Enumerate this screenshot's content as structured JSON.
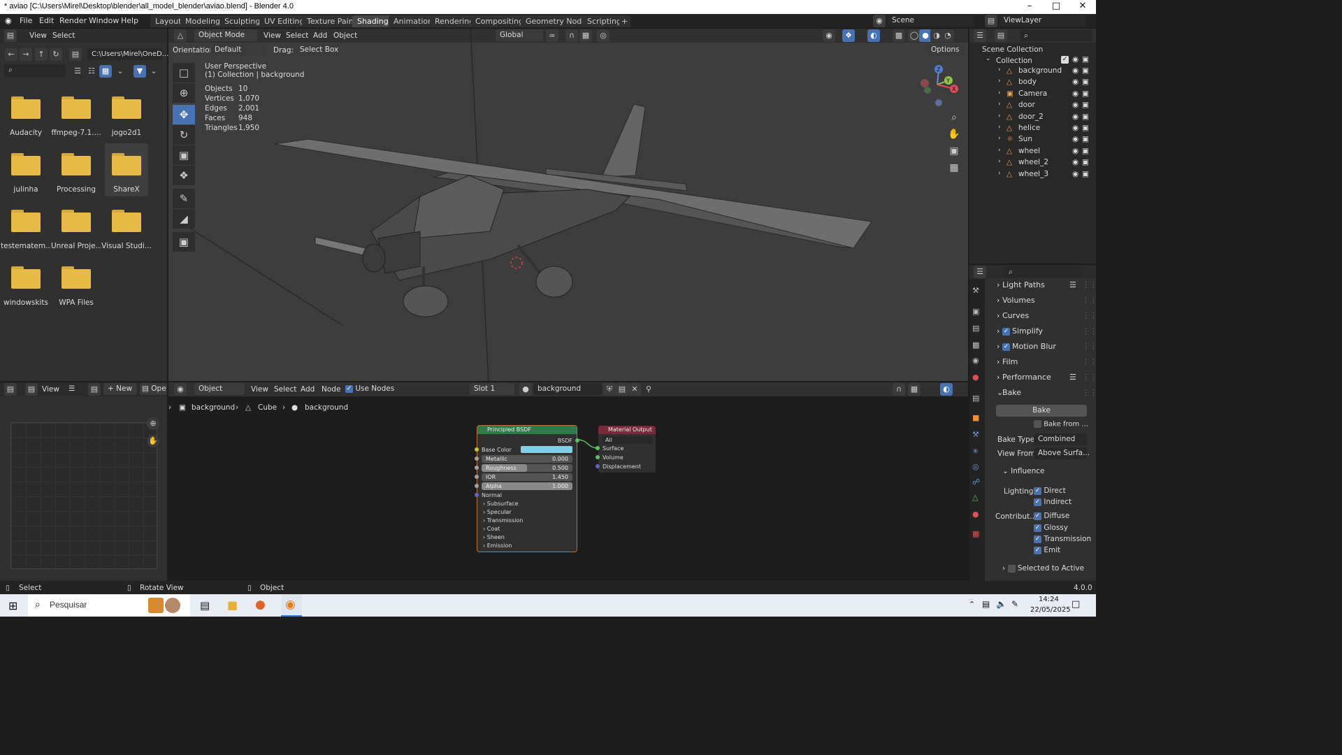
{
  "window": {
    "title": "* aviao [C:\\Users\\Mirel\\Desktop\\blender\\all_model_blender\\aviao.blend] - Blender 4.0"
  },
  "menu": [
    "File",
    "Edit",
    "Render",
    "Window",
    "Help"
  ],
  "workspaces": [
    "Layout",
    "Modeling",
    "Sculpting",
    "UV Editing",
    "Texture Paint",
    "Shading",
    "Animation",
    "Rendering",
    "Compositing",
    "Geometry Nodes",
    "Scripting"
  ],
  "active_workspace": "Shading",
  "scene": {
    "label": "Scene",
    "viewlayer": "ViewLayer"
  },
  "file_browser": {
    "menu": [
      "View",
      "Select"
    ],
    "path": "C:\\Users\\Mirel\\OneD...",
    "folders": [
      "Audacity",
      "ffmpeg-7.1....",
      "jogo2d1",
      "julinha",
      "Processing",
      "ShareX",
      "testematem...",
      "Unreal Proje...",
      "Visual Studi...",
      "windowskits",
      "WPA Files"
    ]
  },
  "viewport": {
    "mode": "Object Mode",
    "menu": [
      "View",
      "Select",
      "Add",
      "Object"
    ],
    "transform": "Global",
    "orientation_label": "Orientation:",
    "orientation": "Default",
    "drag_label": "Drag:",
    "drag": "Select Box",
    "options": "Options",
    "perspective": "User Perspective",
    "collection": "(1) Collection | background",
    "stats": [
      {
        "k": "Objects",
        "v": "10"
      },
      {
        "k": "Vertices",
        "v": "1,070"
      },
      {
        "k": "Edges",
        "v": "2,001"
      },
      {
        "k": "Faces",
        "v": "948"
      },
      {
        "k": "Triangles",
        "v": "1,950"
      }
    ],
    "gizmo": {
      "z": "Z",
      "y": "Y",
      "x": "X"
    }
  },
  "outliner": {
    "root": "Scene Collection",
    "collection": "Collection",
    "items": [
      "background",
      "body",
      "Camera",
      "door",
      "door_2",
      "helice",
      "Sun",
      "wheel",
      "wheel_2",
      "wheel_3"
    ]
  },
  "properties": {
    "panels": [
      "Light Paths",
      "Volumes",
      "Curves",
      "Simplify",
      "Motion Blur",
      "Film",
      "Performance",
      "Bake"
    ],
    "bake_button": "Bake",
    "bake_from": "Bake from ...",
    "bake_type_label": "Bake Type",
    "bake_type": "Combined",
    "view_from_label": "View From",
    "view_from": "Above Surfa...",
    "influence": "Influence",
    "lighting_label": "Lighting",
    "direct": "Direct",
    "indirect": "Indirect",
    "contrib_label": "Contribut...",
    "diffuse": "Diffuse",
    "glossy": "Glossy",
    "transmission": "Transmission",
    "emit": "Emit",
    "selected_to_active": "Selected to Active"
  },
  "image_editor": {
    "view": "View",
    "new": "New",
    "open": "Ope"
  },
  "node_editor": {
    "type": "Object",
    "menu": [
      "View",
      "Select",
      "Add",
      "Node"
    ],
    "use_nodes": "Use Nodes",
    "slot": "Slot 1",
    "material": "background",
    "breadcrumb": [
      "background",
      "Cube",
      "background"
    ],
    "bsdf": {
      "title": "Principled BSDF",
      "out": "BSDF",
      "base_color": "Base Color",
      "base_color_hex": "#7fd1e8",
      "fields": [
        {
          "k": "Metallic",
          "v": "0.000",
          "fill": 0
        },
        {
          "k": "Roughness",
          "v": "0.500",
          "fill": 0.5
        },
        {
          "k": "IOR",
          "v": "1.450",
          "fill": 0
        },
        {
          "k": "Alpha",
          "v": "1.000",
          "fill": 1
        }
      ],
      "normal": "Normal",
      "sub": [
        "Subsurface",
        "Specular",
        "Transmission",
        "Coat",
        "Sheen",
        "Emission"
      ]
    },
    "output": {
      "title": "Material Output",
      "target": "All",
      "inputs": [
        "Surface",
        "Volume",
        "Displacement"
      ]
    }
  },
  "statusbar": {
    "select": "Select",
    "rotate": "Rotate View",
    "object": "Object",
    "version": "4.0.0"
  },
  "taskbar": {
    "search": "Pesquisar",
    "time": "14:24",
    "date": "22/05/2025"
  }
}
